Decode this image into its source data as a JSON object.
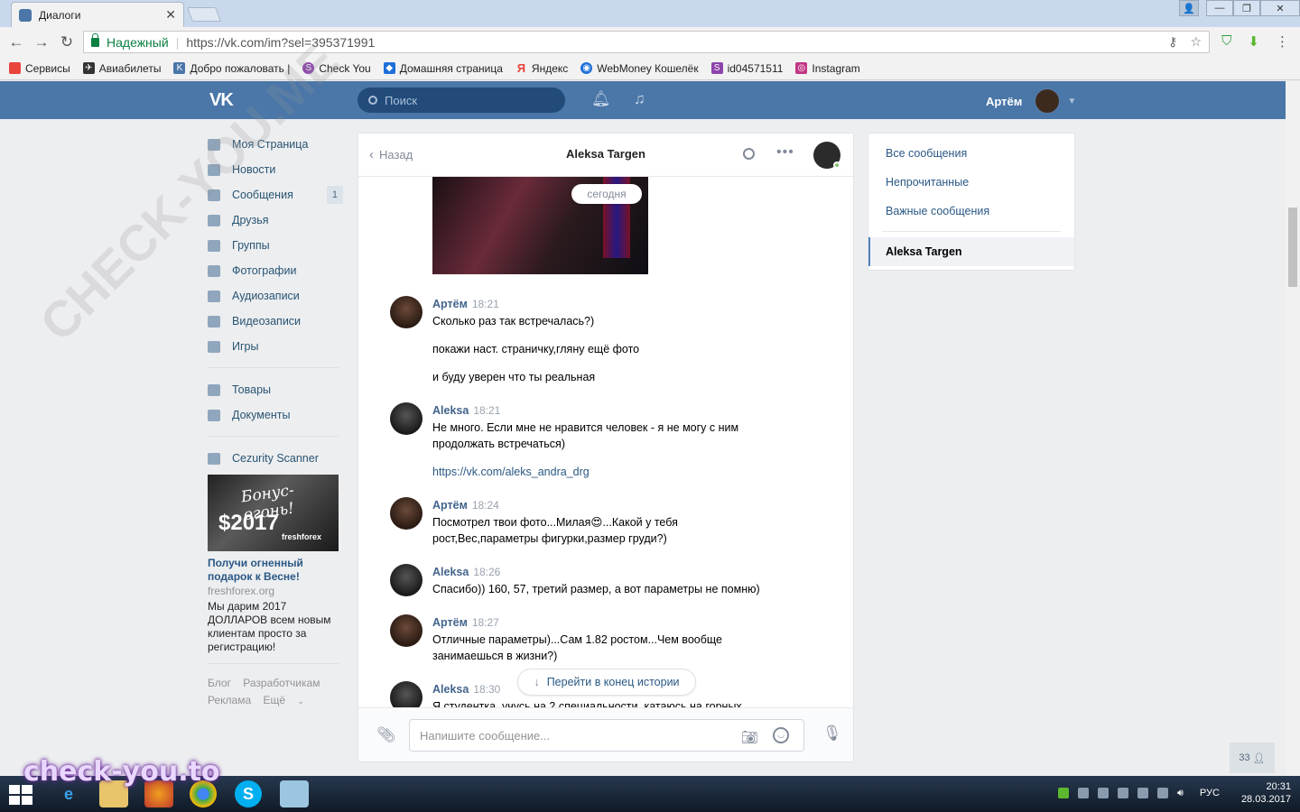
{
  "browser": {
    "tab_title": "Диалоги",
    "tab_close": "✕",
    "secure_label": "Надежный",
    "url": "https://vk.com/im?sel=395371991",
    "nav_back": "←",
    "nav_forward": "→",
    "nav_reload": "↻",
    "bookmarks": [
      {
        "label": "Сервисы",
        "color": "#e8453c"
      },
      {
        "label": "Авиабилеты",
        "color": "#333333"
      },
      {
        "label": "Добро пожаловать |",
        "color": "#4a76a8"
      },
      {
        "label": "Check You",
        "color": "#8e44ad"
      },
      {
        "label": "Домашняя страница",
        "color": "#1e6fd9"
      },
      {
        "label": "Яндекс",
        "color": "#e8453c"
      },
      {
        "label": "WebMoney Кошелёк",
        "color": "#1e6fd9"
      },
      {
        "label": "id04571511",
        "color": "#8e44ad"
      },
      {
        "label": "Instagram",
        "color": "#c13584"
      }
    ]
  },
  "vk": {
    "logo": "VK",
    "search_placeholder": "Поиск",
    "user_name": "Артём",
    "menu": [
      {
        "label": "Моя Страница",
        "badge": ""
      },
      {
        "label": "Новости",
        "badge": ""
      },
      {
        "label": "Сообщения",
        "badge": "1"
      },
      {
        "label": "Друзья",
        "badge": ""
      },
      {
        "label": "Группы",
        "badge": ""
      },
      {
        "label": "Фотографии",
        "badge": ""
      },
      {
        "label": "Аудиозаписи",
        "badge": ""
      },
      {
        "label": "Видеозаписи",
        "badge": ""
      },
      {
        "label": "Игры",
        "badge": ""
      }
    ],
    "menu2": [
      {
        "label": "Товары"
      },
      {
        "label": "Документы"
      }
    ],
    "menu3": [
      {
        "label": "Cezurity Scanner"
      }
    ],
    "ad": {
      "img_line1": "Бонус-огонь!",
      "img_line2": "$2017",
      "img_line3": "freshforex",
      "title": "Получи огненный подарок к Весне!",
      "domain": "freshforex.org",
      "text": "Мы дарим 2017 ДОЛЛАРОВ всем новым клиентам просто за регистрацию!"
    },
    "footer_links": [
      "Блог",
      "Разработчикам",
      "Реклама",
      "Ещё"
    ]
  },
  "chat": {
    "back_label": "Назад",
    "peer_name": "Aleksa Targen",
    "date_pill": "сегодня",
    "messages": [
      {
        "author": "Артём",
        "time": "18:21",
        "lines": [
          "Сколько раз так встречалась?)",
          "покажи наст. страничку,гляну ещё фото",
          "и буду уверен что ты реальная"
        ]
      },
      {
        "author": "Aleksa",
        "time": "18:21",
        "lines": [
          "Не много. Если мне не нравится человек - я не могу с ним продолжать встречаться)",
          "https://vk.com/aleks_andra_drg"
        ]
      },
      {
        "author": "Артём",
        "time": "18:24",
        "lines": [
          "Посмотрел твои фото...Милая😍...Какой у тебя рост,Вес,параметры фигурки,размер груди?)"
        ]
      },
      {
        "author": "Aleksa",
        "time": "18:26",
        "lines": [
          "Спасибо)) 160, 57, третий размер, а вот параметры не помню)"
        ]
      },
      {
        "author": "Артём",
        "time": "18:27",
        "lines": [
          "Отличные параметры)...Сам 1.82 ростом...Чем вообще занимаешься в жизни?)"
        ]
      },
      {
        "author": "Aleksa",
        "time": "18:30",
        "lines": [
          "Я студентка, учусь на 2 специальности, катаюсь на горных"
        ]
      }
    ],
    "jump_label": "Перейти в конец истории",
    "input_placeholder": "Напишите сообщение..."
  },
  "right_panel": {
    "items": [
      "Все сообщения",
      "Непрочитанные",
      "Важные сообщения"
    ],
    "active": "Aleksa Targen"
  },
  "counter": "33",
  "taskbar": {
    "lang": "РУС",
    "time": "20:31",
    "date": "28.03.2017"
  },
  "watermark": "check-you.to",
  "watermark_diag": "CHECK-YOU.ME"
}
